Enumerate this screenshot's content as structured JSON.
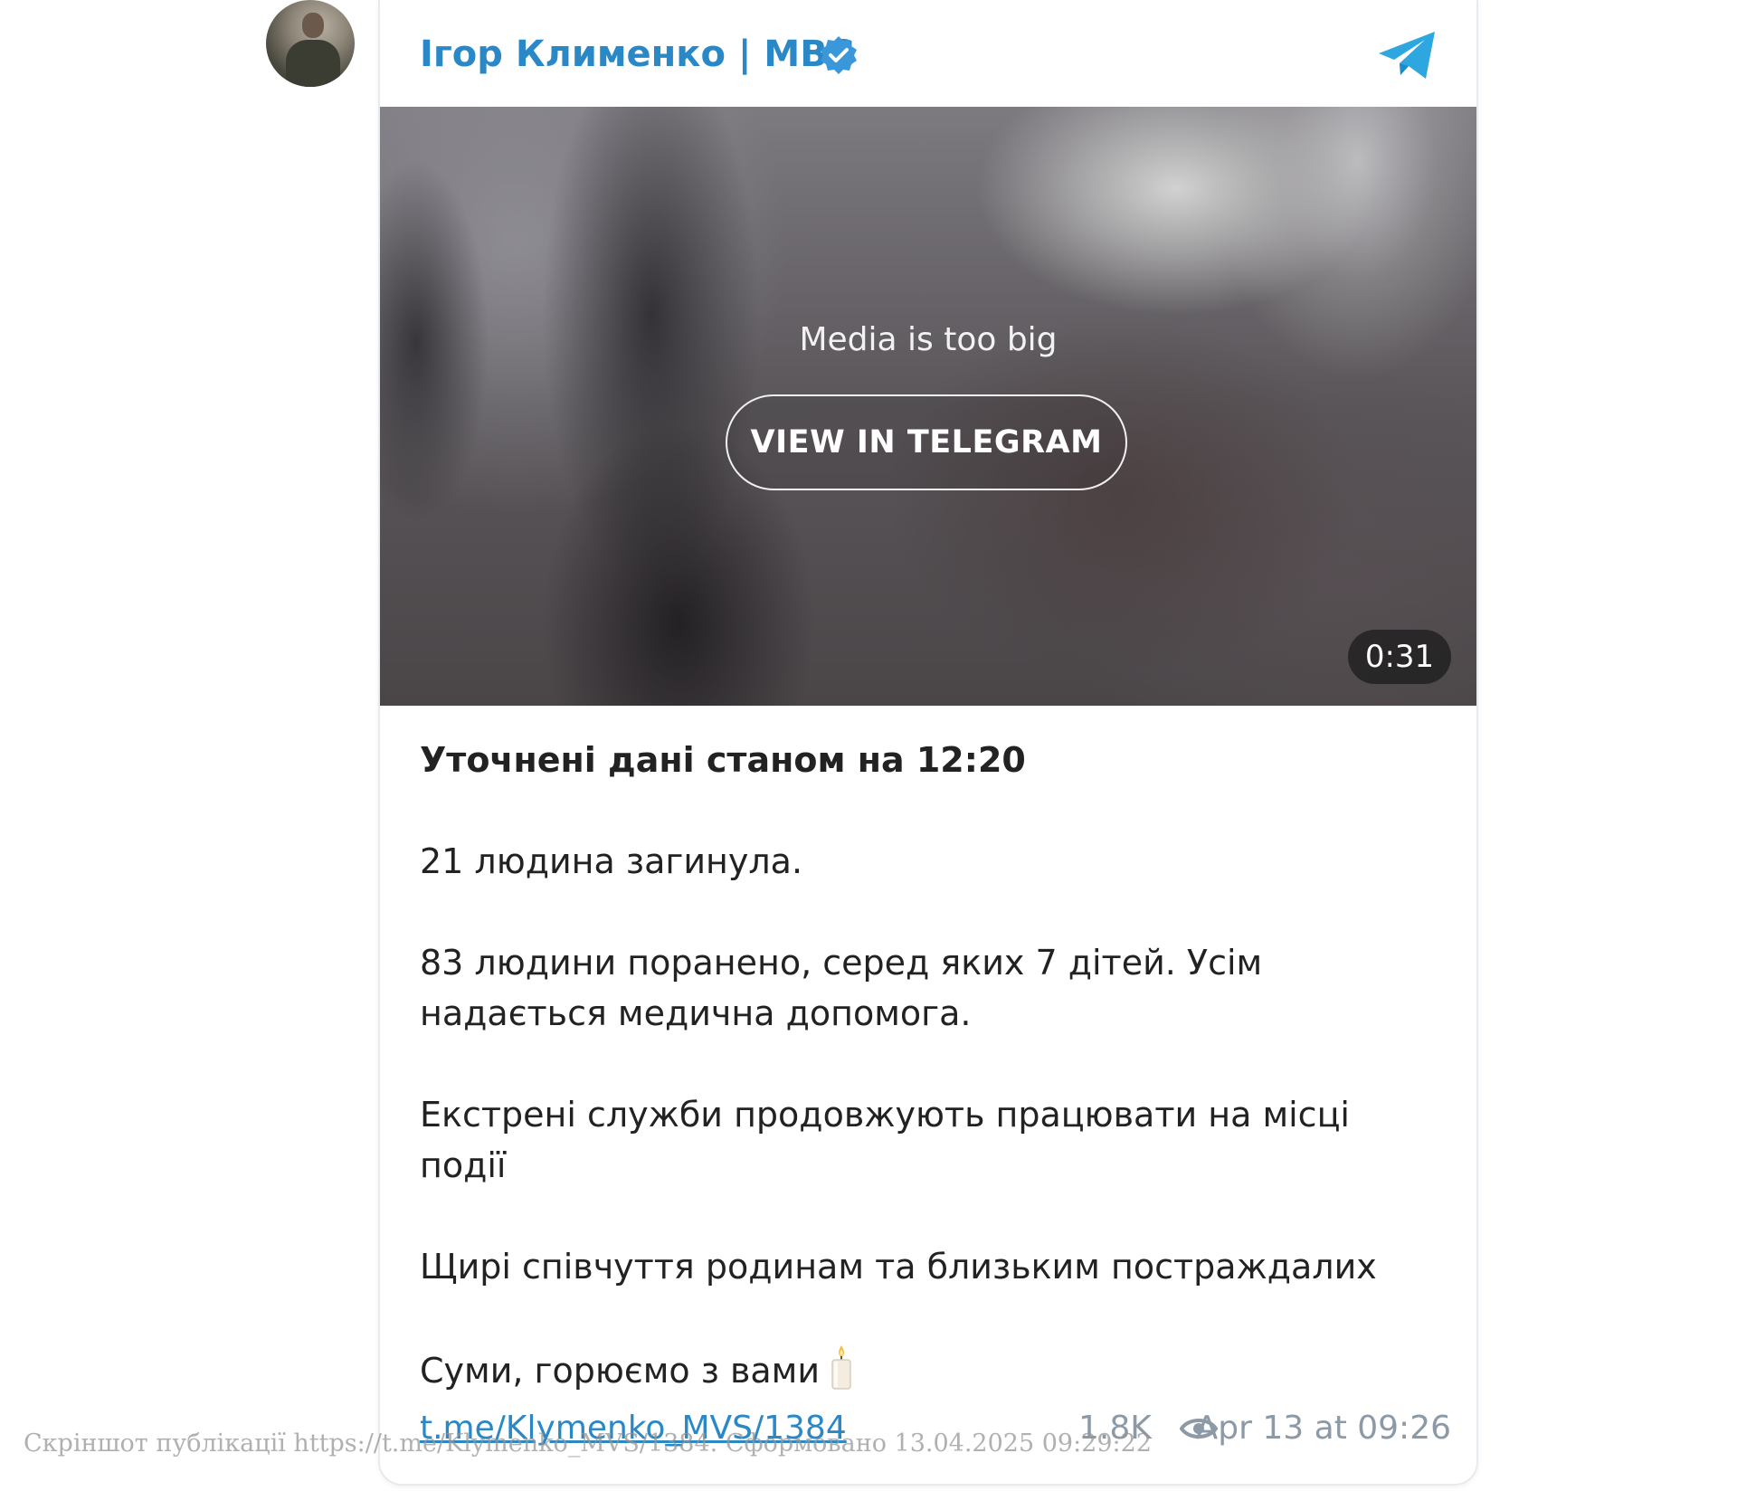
{
  "channel": {
    "name": "Ігор Клименко | МВС",
    "accent_color": "#2a88c7"
  },
  "media": {
    "notice": "Media is too big",
    "button_label": "VIEW IN TELEGRAM",
    "duration": "0:31"
  },
  "post": {
    "title": "Уточнені дані станом на 12:20",
    "paragraphs": [
      "21 людина загинула.",
      "83 людини поранено, серед яких 7 дітей. Усім надається медична допомога.",
      "Екстрені служби продовжують працювати на місці події",
      "Щирі співчуття родинам та близьким постраждалих",
      "Суми, горюємо з вами"
    ]
  },
  "footer": {
    "link": "t.me/Klymenko_MVS/1384",
    "views": "1.8K",
    "date": "Apr 13 at 09:26"
  },
  "watermark": "Скріншот публікації https://t.me/Klymenko_MVS/1384. Сформовано 13.04.2025 09:29:22",
  "icons": {
    "verified": "verified-badge-icon",
    "telegram": "telegram-logo-icon",
    "views": "eye-icon",
    "candle": "candle-icon"
  }
}
